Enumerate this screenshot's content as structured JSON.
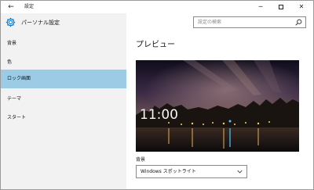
{
  "titlebar": {
    "title": "設定",
    "back_glyph": "←",
    "minimize_glyph": "─",
    "close_glyph": "✕"
  },
  "sidebar": {
    "title": "パーソナル設定",
    "items": [
      {
        "label": "背景",
        "selected": false
      },
      {
        "label": "色",
        "selected": false
      },
      {
        "label": "ロック画面",
        "selected": true
      },
      {
        "label": "テーマ",
        "selected": false
      },
      {
        "label": "スタート",
        "selected": false
      }
    ]
  },
  "search": {
    "placeholder": "設定の検索",
    "icon": "search-icon"
  },
  "main": {
    "section_title": "プレビュー",
    "preview_time": "11:00",
    "background_label": "背景",
    "background_value": "Windows スポットライト"
  },
  "colors": {
    "selected_nav": "#9ccbe6",
    "sidebar_bg": "#f2f2f2",
    "accent": "#0078d7"
  }
}
